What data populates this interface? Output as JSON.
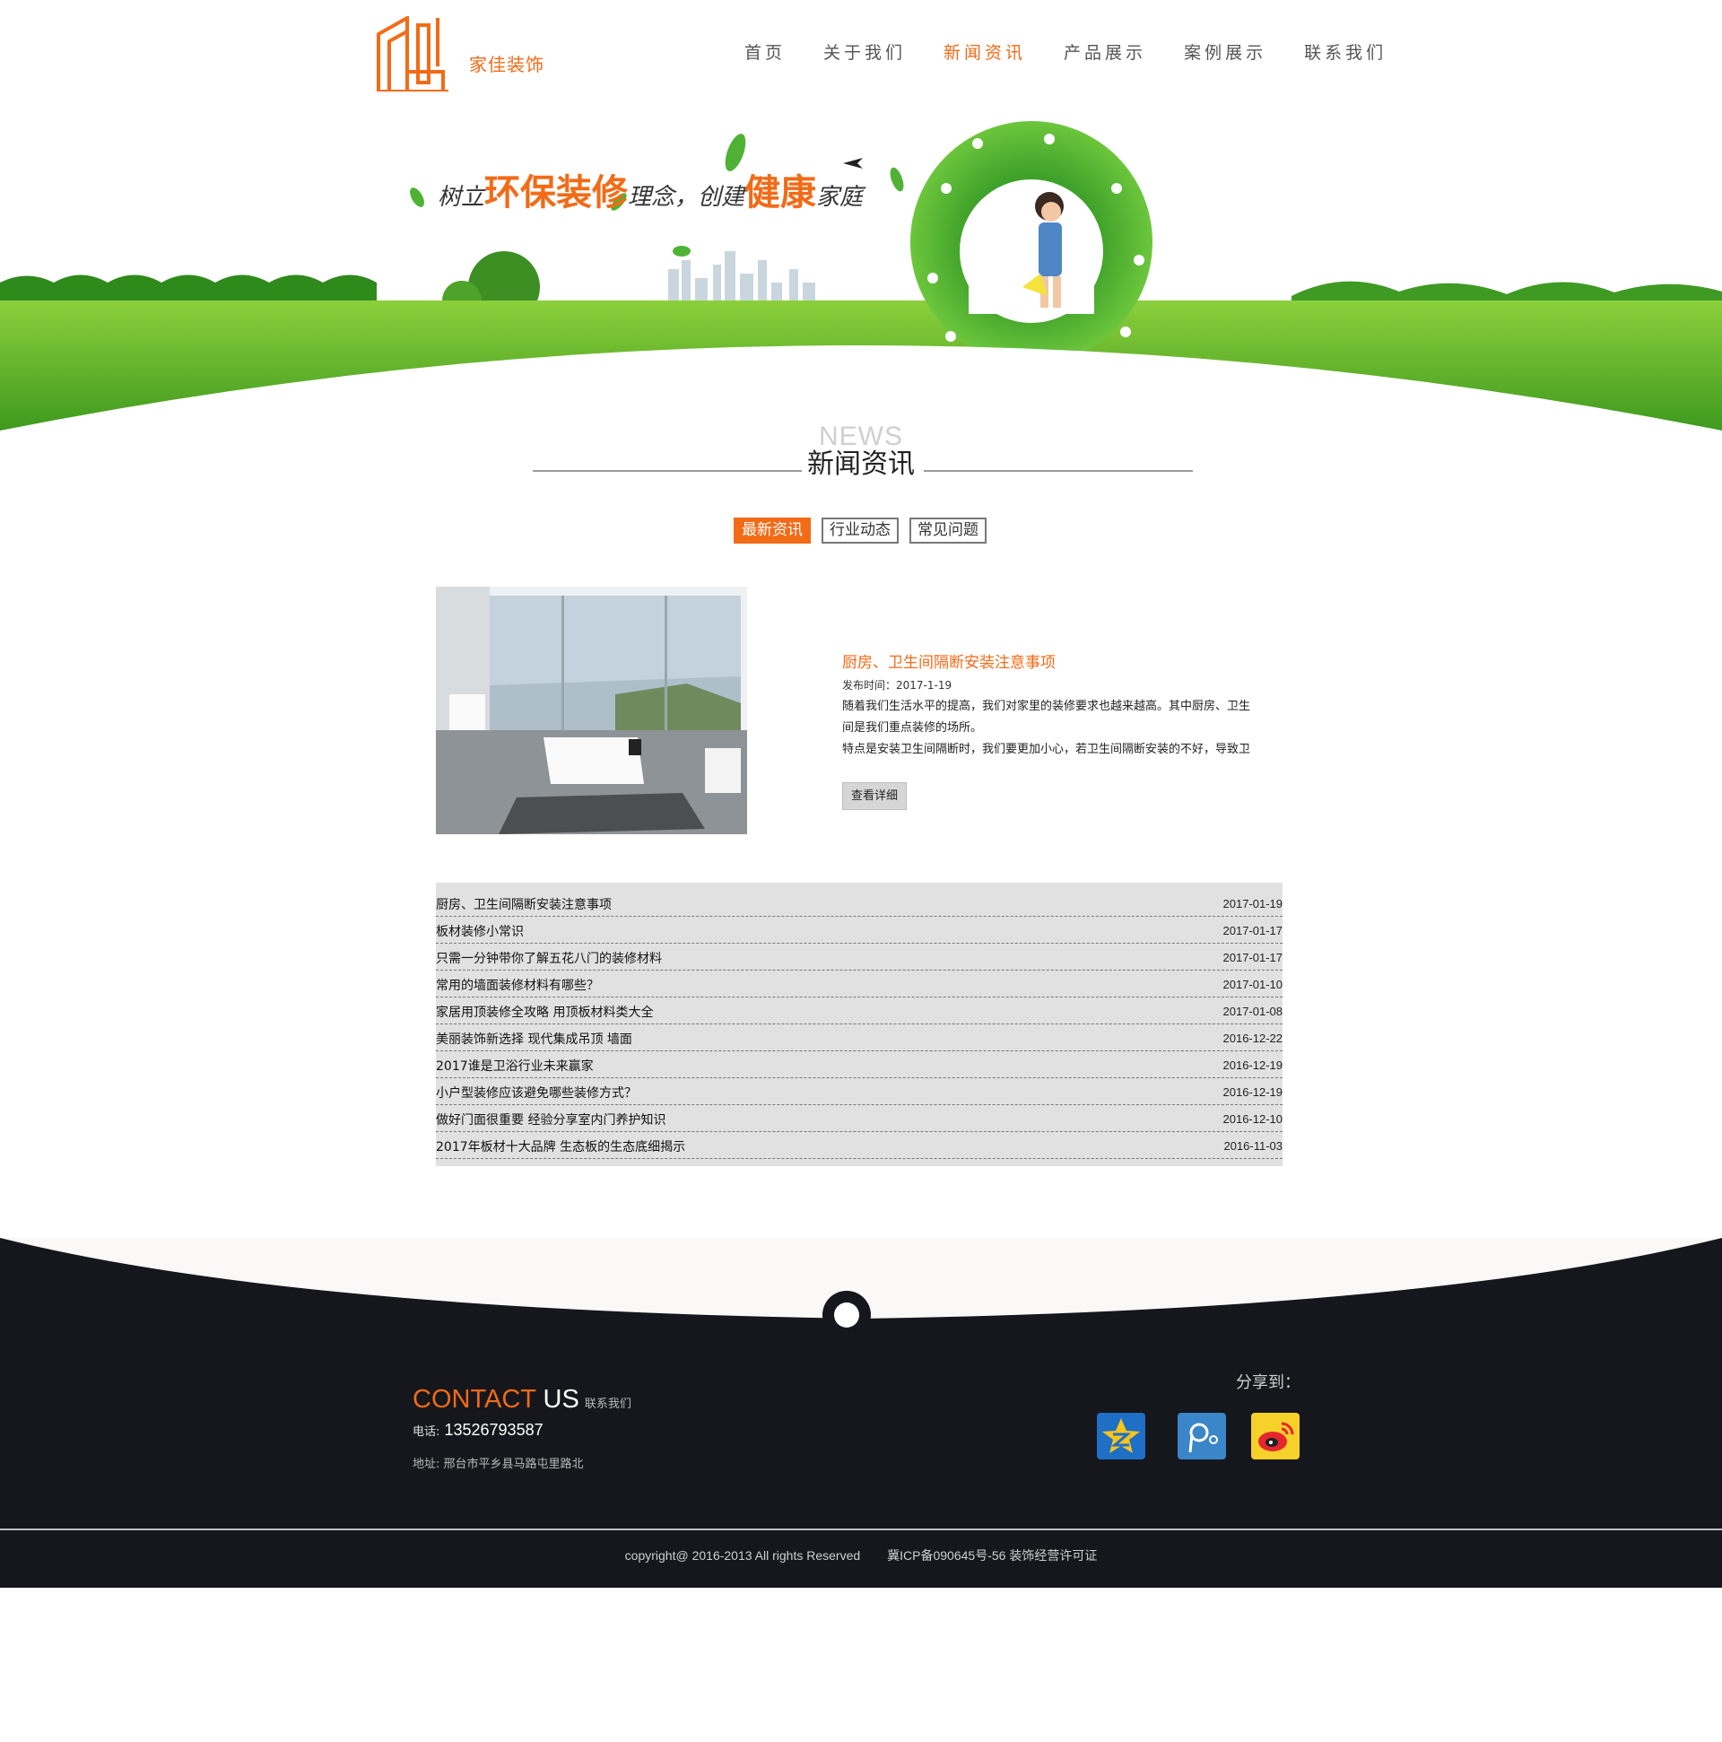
{
  "brand": {
    "name": "家佳装饰",
    "accent_color": "#f26b17"
  },
  "nav": {
    "items": [
      {
        "label": "首页",
        "active": false
      },
      {
        "label": "关于我们",
        "active": false
      },
      {
        "label": "新闻资讯",
        "active": true
      },
      {
        "label": "产品展示",
        "active": false
      },
      {
        "label": "案例展示",
        "active": false
      },
      {
        "label": "联系我们",
        "active": false
      }
    ]
  },
  "banner": {
    "slogan_part1": "树立",
    "slogan_hl1": "环保装修",
    "slogan_part2": "理念，创建",
    "slogan_hl2": "健康",
    "slogan_part3": "家庭"
  },
  "section": {
    "title_en": "NEWS",
    "title_cn": "新闻资讯"
  },
  "tabs": [
    {
      "label": "最新资讯",
      "active": true
    },
    {
      "label": "行业动态",
      "active": false
    },
    {
      "label": "常见问题",
      "active": false
    }
  ],
  "featured": {
    "title": "厨房、卫生间隔断安装注意事项",
    "date": "发布时间：2017-1-19",
    "body_lines": [
      "随着我们生活水平的提高，我们对家里的装修要求也越来越高。其中厨房、卫生",
      "间是我们重点装修的场所。",
      "特点是安装卫生间隔断时，我们要更加小心，若卫生间隔断安装的不好，导致卫"
    ],
    "button_label": "查看详细"
  },
  "news": [
    {
      "title": "厨房、卫生间隔断安装注意事项",
      "date": "2017-01-19"
    },
    {
      "title": "板材装修小常识",
      "date": "2017-01-17"
    },
    {
      "title": "只需一分钟带你了解五花八门的装修材料",
      "date": "2017-01-17"
    },
    {
      "title": "常用的墙面装修材料有哪些？",
      "date": "2017-01-10"
    },
    {
      "title": "家居用顶装修全攻略 用顶板材料类大全",
      "date": "2017-01-08"
    },
    {
      "title": "美丽装饰新选择 现代集成吊顶 墙面",
      "date": "2016-12-22"
    },
    {
      "title": "2017谁是卫浴行业未来赢家",
      "date": "2016-12-19"
    },
    {
      "title": "小户型装修应该避免哪些装修方式？",
      "date": "2016-12-19"
    },
    {
      "title": "做好门面很重要 经验分享室内门养护知识",
      "date": "2016-12-10"
    },
    {
      "title": "2017年板材十大品牌 生态板的生态底细揭示",
      "date": "2016-11-03"
    }
  ],
  "footer": {
    "contact_en_1": "CONTACT",
    "contact_en_2": " US",
    "contact_cn": "联系我们",
    "phone_label": "电话:",
    "phone": "13526793587",
    "address": "地址: 邢台市平乡县马路屯里路北",
    "share_label": "分享到：",
    "share_icons": [
      "qzone-icon",
      "tencent-weibo-icon",
      "sina-weibo-icon"
    ],
    "copyright": "copyright@ 2016-2013   All rights Reserved",
    "icp": "冀ICP备090645号-56 装饰经营许可证"
  }
}
